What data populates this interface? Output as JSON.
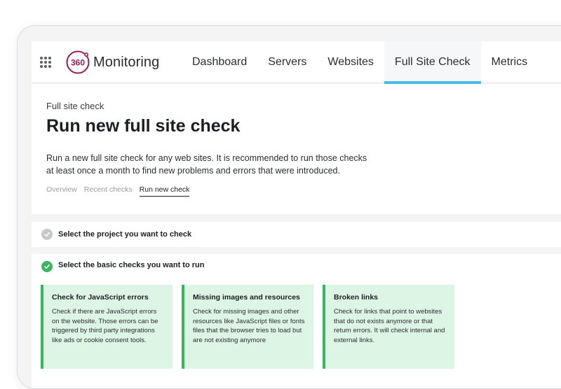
{
  "app": {
    "brand_number": "360",
    "brand_name": "Monitoring"
  },
  "nav": {
    "items": [
      {
        "label": "Dashboard"
      },
      {
        "label": "Servers"
      },
      {
        "label": "Websites"
      },
      {
        "label": "Full Site Check",
        "active": true
      },
      {
        "label": "Metrics"
      }
    ]
  },
  "header": {
    "breadcrumb": "Full site check",
    "title": "Run new full site check",
    "description": "Run a new full site check for any web sites. It is recommended to run those checks at least once a month to find new problems and errors that were introduced.",
    "subtabs": [
      {
        "label": "Overview"
      },
      {
        "label": "Recent checks"
      },
      {
        "label": "Run new check",
        "active": true
      }
    ]
  },
  "steps": [
    {
      "label": "Select the project you want to check",
      "status": "pending"
    },
    {
      "label": "Select the basic checks you want to run",
      "status": "done"
    }
  ],
  "cards": [
    {
      "title": "Check for JavaScript errors",
      "text": "Check if there are JavaScript errors on the website. Those errors can be triggered by third party integrations like ads or cookie consent tools."
    },
    {
      "title": "Missing images and resources",
      "text": "Check for missing images and other resources like JavaScript files or fonts files that the browser tries to load but are not existing anymore"
    },
    {
      "title": "Broken links",
      "text": "Check for links that point to websites that do not exists anymore or that return errors. It will check internal and external links."
    }
  ],
  "colors": {
    "accent": "#48bce6",
    "success": "#3cb563",
    "card_bg": "#ddf5e4",
    "logo": "#9b1b55"
  }
}
